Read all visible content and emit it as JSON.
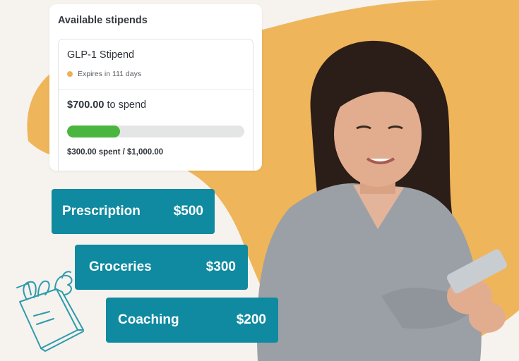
{
  "card": {
    "title": "Available stipends",
    "stipend_name": "GLP-1 Stipend",
    "expiry_text": "Expires in 111 days",
    "amount": "$700.00",
    "amount_suffix": " to spend",
    "progress_fraction": 0.3,
    "spent_text": "$300.00 spent / $1,000.00"
  },
  "categories": [
    {
      "label": "Prescription",
      "amount": "$500"
    },
    {
      "label": "Groceries",
      "amount": "$300"
    },
    {
      "label": "Coaching",
      "amount": "$200"
    }
  ],
  "colors": {
    "background": "#f6f2ee",
    "blob": "#efb55a",
    "pill": "#0f8aa0",
    "progress": "#4ab63f",
    "expiry_dot": "#e9b250"
  },
  "icons": [
    "grocery-bag-icon"
  ]
}
